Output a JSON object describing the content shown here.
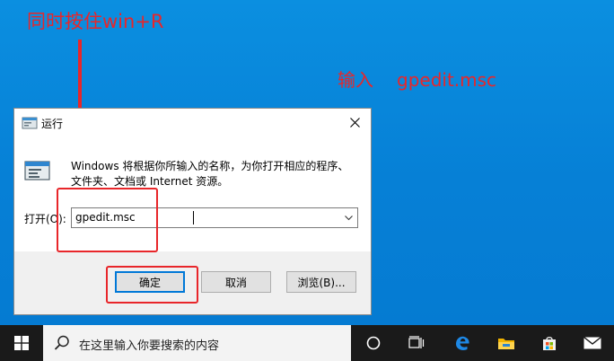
{
  "annotations": {
    "shortcut_hint": "同时按住win+R",
    "input_hint_label": "输入",
    "input_hint_command": "gpedit.msc"
  },
  "dialog": {
    "title": "运行",
    "description": "Windows 将根据你所输入的名称，为你打开相应的程序、文件夹、文档或 Internet 资源。",
    "open_label": "打开(O):",
    "command_value": "gpedit.msc",
    "buttons": {
      "ok": "确定",
      "cancel": "取消",
      "browse": "浏览(B)..."
    }
  },
  "taskbar": {
    "search_placeholder": "在这里输入你要搜索的内容"
  },
  "colors": {
    "annotation_red": "#e8262a",
    "desktop_blue": "#0680d6",
    "taskbar": "#1a1a1a",
    "focus_blue": "#0078d7"
  },
  "icons": [
    "run-icon",
    "close-icon",
    "chevron-down-icon",
    "windows-icon",
    "search-icon",
    "cortana-icon",
    "task-view-icon",
    "edge-icon",
    "file-explorer-icon",
    "store-icon",
    "mail-icon"
  ]
}
